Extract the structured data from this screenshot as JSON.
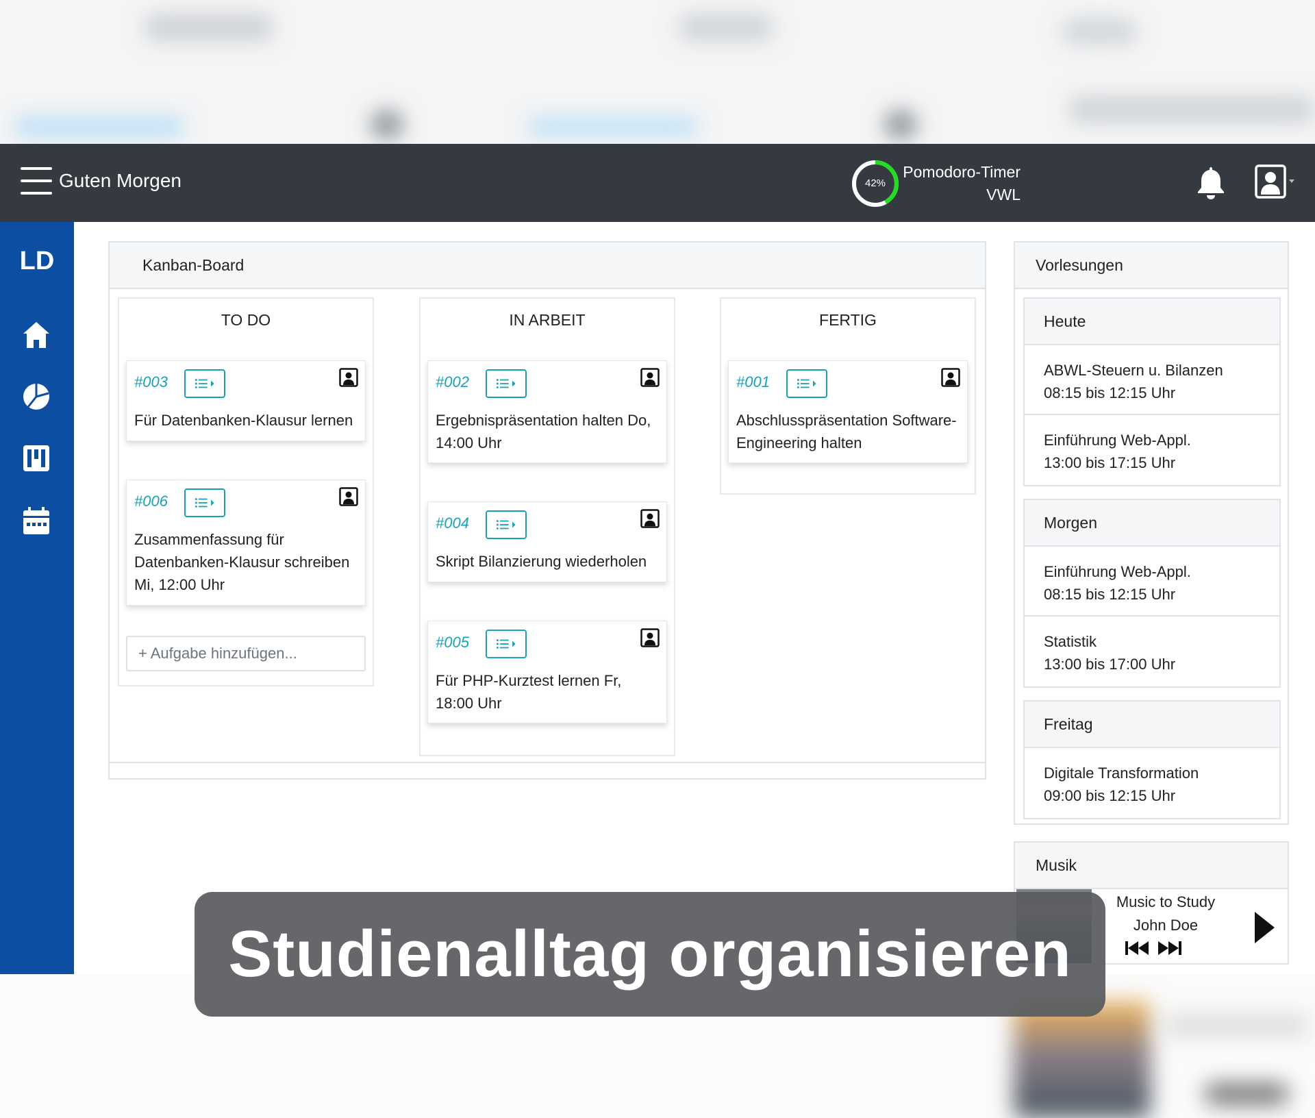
{
  "navbar": {
    "greeting": "Guten Morgen",
    "pomodoro": {
      "percent_label": "42%",
      "progress": 0.42,
      "title": "Pomodoro-Timer",
      "subject": "VWL",
      "ring_color": "#22dd22"
    }
  },
  "sidebar": {
    "logo": "LD",
    "items": [
      {
        "icon": "home-icon"
      },
      {
        "icon": "pie-chart-icon"
      },
      {
        "icon": "kanban-icon"
      },
      {
        "icon": "calendar-icon"
      }
    ],
    "color": "#0b4ea2"
  },
  "kanban": {
    "title": "Kanban-Board",
    "columns": [
      {
        "title": "TO DO",
        "cards": [
          {
            "id": "#003",
            "text": "Für Datenbanken-Klausur lernen"
          },
          {
            "id": "#006",
            "text": "Zusammenfassung für Datenbanken-Klausur schreiben Mi, 12:00 Uhr"
          }
        ],
        "add_placeholder": "+ Aufgabe hinzufügen..."
      },
      {
        "title": "IN ARBEIT",
        "cards": [
          {
            "id": "#002",
            "text": "Ergebnispräsentation halten Do, 14:00 Uhr"
          },
          {
            "id": "#004",
            "text": "Skript Bilanzierung wiederholen"
          },
          {
            "id": "#005",
            "text": "Für PHP-Kurztest lernen Fr, 18:00 Uhr"
          }
        ]
      },
      {
        "title": "FERTIG",
        "cards": [
          {
            "id": "#001",
            "text": "Abschlusspräsentation Software-Engineering halten"
          }
        ]
      }
    ],
    "accent": "#17a2b8"
  },
  "lectures": {
    "title": "Vorlesungen",
    "days": [
      {
        "label": "Heute",
        "items": [
          {
            "name": "ABWL-Steuern u. Bilanzen",
            "time": "08:15 bis 12:15 Uhr"
          },
          {
            "name": "Einführung Web-Appl.",
            "time": "13:00 bis 17:15 Uhr"
          }
        ]
      },
      {
        "label": "Morgen",
        "items": [
          {
            "name": "Einführung Web-Appl.",
            "time": "08:15 bis 12:15 Uhr"
          },
          {
            "name": "Statistik",
            "time": "13:00 bis 17:00 Uhr"
          }
        ]
      },
      {
        "label": "Freitag",
        "items": [
          {
            "name": "Digitale Transformation",
            "time": "09:00 bis 12:15 Uhr"
          }
        ]
      }
    ]
  },
  "music": {
    "title": "Musik",
    "track": "Music to Study",
    "artist": "John Doe"
  },
  "caption": "Studienalltag organisieren"
}
